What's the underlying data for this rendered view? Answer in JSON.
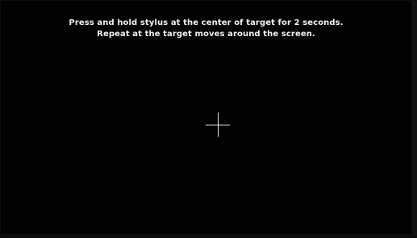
{
  "calibration": {
    "instruction_line_1": "Press and hold stylus at the center of target for 2 seconds.",
    "instruction_line_2": "Repeat at the target moves around the screen.",
    "target_icon": "crosshair-icon"
  },
  "colors": {
    "background": "#020202",
    "text": "#f2f2f2",
    "target": "#e8e8e8"
  }
}
